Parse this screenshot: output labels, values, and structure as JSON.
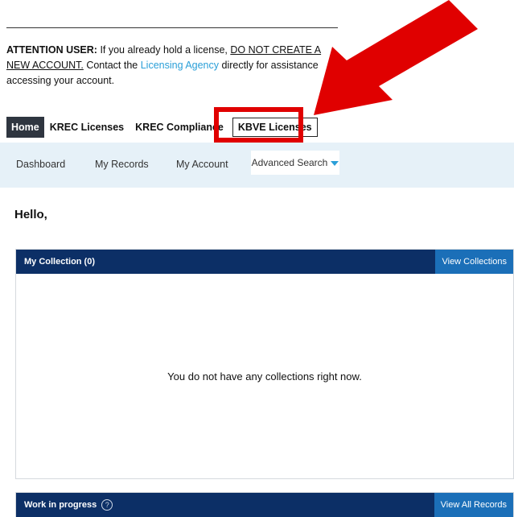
{
  "attention": {
    "lead": "ATTENTION USER:",
    "text1": " If you already hold a license, ",
    "underlined1": "DO NOT CREATE A NEW ACCOUNT.",
    "text2": " Contact the ",
    "agency_link": "Licensing Agency",
    "text3": " directly for assistance accessing your account."
  },
  "tabs": [
    {
      "label": "Home",
      "active": true
    },
    {
      "label": "KREC Licenses"
    },
    {
      "label": "KREC Compliance"
    },
    {
      "label": "KBVE Licenses",
      "highlighted": true
    }
  ],
  "subnav": {
    "dashboard": "Dashboard",
    "my_records": "My Records",
    "my_account": "My Account",
    "advanced_search": "Advanced Search"
  },
  "greeting": "Hello,",
  "collection_panel": {
    "title": "My Collection (0)",
    "button": "View Collections",
    "empty_message": "You do not have any collections right now."
  },
  "wip_panel": {
    "title": "Work in progress",
    "button": "View All Records"
  },
  "colors": {
    "accent": "#2a9fd8",
    "panel_header": "#0c2f66",
    "panel_button": "#1b6fb8",
    "highlight": "#e00000"
  }
}
